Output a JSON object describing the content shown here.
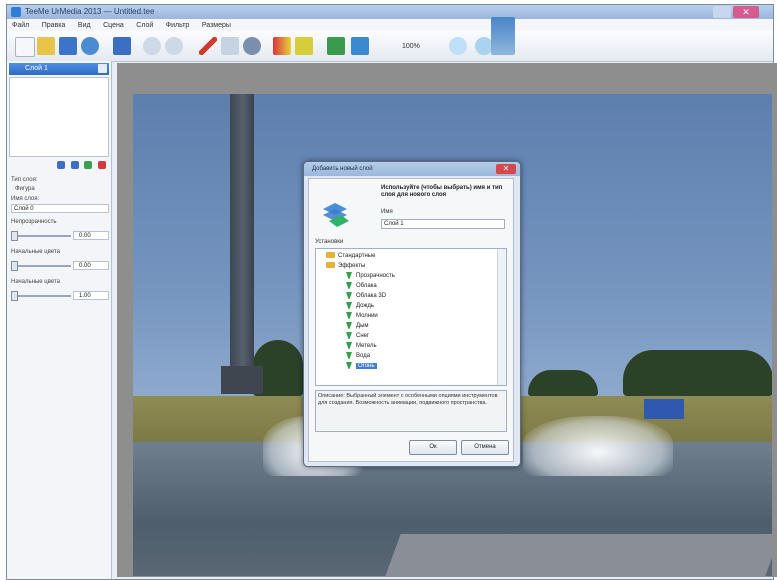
{
  "window": {
    "title": "TeeMe UrMedia 2013 — Untitled.tee",
    "close_glyph": "✕"
  },
  "menubar": [
    "Файл",
    "Правка",
    "Вид",
    "Сцена",
    "Слой",
    "Фильтр",
    "Размеры"
  ],
  "toolbar": {
    "zoom": "100%",
    "tools": [
      "new-icon",
      "open-icon",
      "save-icon",
      "layers-icon",
      "image-icon",
      "undo-icon",
      "redo-icon",
      "pencil-icon",
      "lasso-icon",
      "color-icon",
      "fill-icon",
      "effect-icon",
      "adjust-icon",
      "crop-icon",
      "zoom-in-icon",
      "zoom-out-icon"
    ]
  },
  "layers_panel": {
    "title": "Слой 1",
    "type_label": "Тип слоя:",
    "type_value": "Фигура",
    "name_label": "Имя слоя:",
    "name_value": "Слой 0",
    "opacity_label": "Непрозрачность",
    "opacity_value": "0.00",
    "start_label": "Начальные цвета",
    "start_value": "0.00",
    "end_label": "Начальные цвета",
    "end_value": "1.00"
  },
  "dialog": {
    "title": "Добавить новый слой",
    "close_glyph": "✕",
    "prompt": "Используйте (чтобы выбрать) имя и тип слоя для нового слоя",
    "name_label": "Имя",
    "name_value": "Слой 1",
    "tools_label": "Установки",
    "tree": [
      {
        "label": "Стандартные",
        "indent": 0,
        "kind": "folder"
      },
      {
        "label": "Эффекты",
        "indent": 0,
        "kind": "folder"
      },
      {
        "label": "Прозрачность",
        "indent": 1,
        "kind": "item"
      },
      {
        "label": "Облака",
        "indent": 1,
        "kind": "item"
      },
      {
        "label": "Облака 3D",
        "indent": 1,
        "kind": "item"
      },
      {
        "label": "Дождь",
        "indent": 1,
        "kind": "item"
      },
      {
        "label": "Молнии",
        "indent": 1,
        "kind": "item"
      },
      {
        "label": "Дым",
        "indent": 1,
        "kind": "item"
      },
      {
        "label": "Снег",
        "indent": 1,
        "kind": "item"
      },
      {
        "label": "Метель",
        "indent": 1,
        "kind": "item"
      },
      {
        "label": "Вода",
        "indent": 1,
        "kind": "item"
      },
      {
        "label": "Огонь",
        "indent": 1,
        "kind": "item",
        "selected": true
      }
    ],
    "description": "Описание: Выбранный элемент с особенными опциями инструментов для создания. Возможность анимации, подвижного пространства.",
    "ok_label": "Ок",
    "cancel_label": "Отмена"
  },
  "colors": {
    "accent": "#3f7fd9",
    "title_close": "#d65a8e"
  }
}
